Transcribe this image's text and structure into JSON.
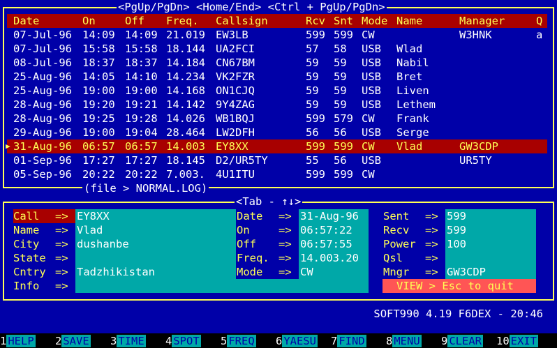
{
  "top_frame": {
    "title": "<PgUp/PgDn> <Home/End> <Ctrl + PgUp/PgDn>",
    "file_label": "(file > NORMAL.LOG)"
  },
  "columns": [
    "Date",
    "On",
    "Off",
    "Freq.",
    "Callsign",
    "Rcv",
    "Snt",
    "Mode",
    "Name",
    "Manager",
    "Q"
  ],
  "rows": [
    {
      "date": "07-Jul-96",
      "on": "14:09",
      "off": "14:09",
      "freq": "21.019",
      "call": "EW3LB",
      "rcv": "599",
      "snt": "599",
      "mode": "CW",
      "name": "",
      "manager": "W3HNK",
      "q": "a"
    },
    {
      "date": "07-Jul-96",
      "on": "15:58",
      "off": "15:58",
      "freq": "18.144",
      "call": "UA2FCI",
      "rcv": "57",
      "snt": "58",
      "mode": "USB",
      "name": "Wlad",
      "manager": "",
      "q": ""
    },
    {
      "date": "08-Jul-96",
      "on": "18:37",
      "off": "18:37",
      "freq": "14.184",
      "call": "CN67BM",
      "rcv": "59",
      "snt": "59",
      "mode": "USB",
      "name": "Nabil",
      "manager": "",
      "q": ""
    },
    {
      "date": "25-Aug-96",
      "on": "14:05",
      "off": "14:10",
      "freq": "14.234",
      "call": "VK2FZR",
      "rcv": "59",
      "snt": "59",
      "mode": "USB",
      "name": "Bret",
      "manager": "",
      "q": ""
    },
    {
      "date": "25-Aug-96",
      "on": "19:00",
      "off": "19:00",
      "freq": "14.168",
      "call": "ON1CJQ",
      "rcv": "59",
      "snt": "59",
      "mode": "USB",
      "name": "Liven",
      "manager": "",
      "q": ""
    },
    {
      "date": "28-Aug-96",
      "on": "19:20",
      "off": "19:21",
      "freq": "14.142",
      "call": "9Y4ZAG",
      "rcv": "59",
      "snt": "59",
      "mode": "USB",
      "name": "Lethem",
      "manager": "",
      "q": ""
    },
    {
      "date": "28-Aug-96",
      "on": "19:25",
      "off": "19:28",
      "freq": "14.026",
      "call": "WB1BQJ",
      "rcv": "599",
      "snt": "579",
      "mode": "CW",
      "name": "Frank",
      "manager": "",
      "q": ""
    },
    {
      "date": "29-Aug-96",
      "on": "19:00",
      "off": "19:04",
      "freq": "28.464",
      "call": "LW2DFH",
      "rcv": "56",
      "snt": "56",
      "mode": "USB",
      "name": "Serge",
      "manager": "",
      "q": ""
    },
    {
      "date": "31-Aug-96",
      "on": "06:57",
      "off": "06:57",
      "freq": "14.003",
      "call": "EY8XX",
      "rcv": "599",
      "snt": "599",
      "mode": "CW",
      "name": "Vlad",
      "manager": "GW3CDP",
      "q": "",
      "selected": true
    },
    {
      "date": "01-Sep-96",
      "on": "17:27",
      "off": "17:27",
      "freq": "18.145",
      "call": "D2/UR5TY",
      "rcv": "55",
      "snt": "56",
      "mode": "USB",
      "name": "",
      "manager": "UR5TY",
      "q": ""
    },
    {
      "date": "05-Sep-96",
      "on": "20:22",
      "off": "20:22",
      "freq": "7.003.",
      "call": "4U1ITU",
      "rcv": "599",
      "snt": "599",
      "mode": "CW",
      "name": "",
      "manager": "",
      "q": ""
    }
  ],
  "detail": {
    "title": "<Tab - ↑↓>",
    "arrow": "=>",
    "col1": [
      {
        "label": "Call",
        "value": "EY8XX",
        "active": true
      },
      {
        "label": "Name",
        "value": "Vlad"
      },
      {
        "label": "City",
        "value": "dushanbe"
      },
      {
        "label": "State",
        "value": ""
      },
      {
        "label": "Cntry",
        "value": "Tadzhikistan"
      },
      {
        "label": "Info",
        "value": ""
      }
    ],
    "col2": [
      {
        "label": "Date",
        "value": "31-Aug-96"
      },
      {
        "label": "On",
        "value": "06:57:22"
      },
      {
        "label": "Off",
        "value": "06:57:55"
      },
      {
        "label": "Freq.",
        "value": "14.003.20"
      },
      {
        "label": "Mode",
        "value": "CW"
      }
    ],
    "col3": [
      {
        "label": "Sent",
        "value": "599"
      },
      {
        "label": "Recv",
        "value": "599"
      },
      {
        "label": "Power",
        "value": "100"
      },
      {
        "label": "Qsl",
        "value": ""
      },
      {
        "label": "Mngr",
        "value": "GW3CDP"
      }
    ],
    "view_button": "VIEW > Esc to quit"
  },
  "status": "SOFT990 4.19 F6DEX - 20:46",
  "fkeys": [
    {
      "n": "1",
      "l": "HELP"
    },
    {
      "n": "2",
      "l": "SAVE"
    },
    {
      "n": "3",
      "l": "TIME"
    },
    {
      "n": "4",
      "l": "SPOT"
    },
    {
      "n": "5",
      "l": "FREQ"
    },
    {
      "n": "6",
      "l": "YAESU"
    },
    {
      "n": "7",
      "l": "FIND"
    },
    {
      "n": "8",
      "l": "MENU"
    },
    {
      "n": "9",
      "l": "CLEAR"
    },
    {
      "n": "10",
      "l": "EXIT"
    }
  ]
}
